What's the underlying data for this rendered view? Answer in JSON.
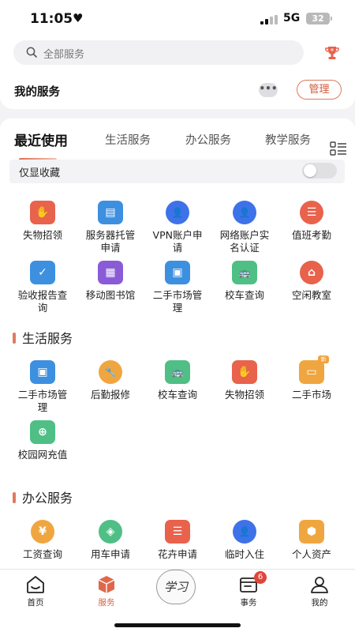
{
  "status": {
    "time": "11:05",
    "network": "5G",
    "battery": "32"
  },
  "search": {
    "placeholder": "全部服务"
  },
  "my_services": {
    "title": "我的服务",
    "more": "•••",
    "manage": "管理"
  },
  "tabs": [
    "最近使用",
    "生活服务",
    "办公服务",
    "教学服务"
  ],
  "favorites_only": {
    "label": "仅显收藏",
    "on": false
  },
  "recent": [
    {
      "label": "失物招领",
      "icon": "lost-found-icon",
      "color": "#e8624c",
      "glyph": "✋"
    },
    {
      "label": "服务器托管申请",
      "icon": "server-hosting-icon",
      "color": "#3d8fe0",
      "glyph": "▤"
    },
    {
      "label": "VPN账户申请",
      "icon": "vpn-account-icon",
      "color": "#3e72e8",
      "glyph": "👤"
    },
    {
      "label": "网络账户实名认证",
      "icon": "network-account-icon",
      "color": "#3e72e8",
      "glyph": "👤"
    },
    {
      "label": "值班考勤",
      "icon": "duty-attendance-icon",
      "color": "#e8624c",
      "glyph": "☰"
    },
    {
      "label": "验收报告查询",
      "icon": "acceptance-report-icon",
      "color": "#3d8fe0",
      "glyph": "✓"
    },
    {
      "label": "移动图书馆",
      "icon": "mobile-library-icon",
      "color": "#8a5bd6",
      "glyph": "▦"
    },
    {
      "label": "二手市场管理",
      "icon": "second-hand-manage-icon",
      "color": "#3d8fe0",
      "glyph": "▣"
    },
    {
      "label": "校车查询",
      "icon": "school-bus-icon",
      "color": "#4fbf85",
      "glyph": "🚌"
    },
    {
      "label": "空闲教室",
      "icon": "free-classroom-icon",
      "color": "#e8624c",
      "glyph": "⌂"
    }
  ],
  "life_section": {
    "title": "生活服务",
    "items": [
      {
        "label": "二手市场管理",
        "icon": "second-hand-manage-icon",
        "color": "#3d8fe0",
        "glyph": "▣"
      },
      {
        "label": "后勤报修",
        "icon": "repair-icon",
        "color": "#f0a640",
        "glyph": "🔧"
      },
      {
        "label": "校车查询",
        "icon": "school-bus-icon",
        "color": "#4fbf85",
        "glyph": "🚌"
      },
      {
        "label": "失物招领",
        "icon": "lost-found-icon",
        "color": "#e8624c",
        "glyph": "✋"
      },
      {
        "label": "二手市场",
        "icon": "second-hand-market-icon",
        "color": "#f0a640",
        "glyph": "▭",
        "badge": "新"
      },
      {
        "label": "校园网充值",
        "icon": "campus-net-recharge-icon",
        "color": "#4fbf85",
        "glyph": "⊕"
      }
    ]
  },
  "office_section": {
    "title": "办公服务",
    "items": [
      {
        "label": "工资查询",
        "icon": "salary-query-icon",
        "color": "#f0a640",
        "glyph": "¥"
      },
      {
        "label": "用车申请",
        "icon": "car-request-icon",
        "color": "#4fbf85",
        "glyph": "◈"
      },
      {
        "label": "花卉申请",
        "icon": "flower-request-icon",
        "color": "#e8624c",
        "glyph": "☰"
      },
      {
        "label": "临时入住",
        "icon": "temp-stay-icon",
        "color": "#3e72e8",
        "glyph": "👤"
      },
      {
        "label": "个人资产",
        "icon": "personal-assets-icon",
        "color": "#f0a640",
        "glyph": "⬢"
      }
    ]
  },
  "bottom_nav": {
    "items": [
      {
        "label": "首页",
        "icon": "home-icon"
      },
      {
        "label": "服务",
        "icon": "service-box-icon"
      },
      {
        "label": "事务",
        "icon": "affairs-icon",
        "badge": "6"
      },
      {
        "label": "我的",
        "icon": "profile-icon"
      }
    ],
    "center_logo": "学习"
  }
}
